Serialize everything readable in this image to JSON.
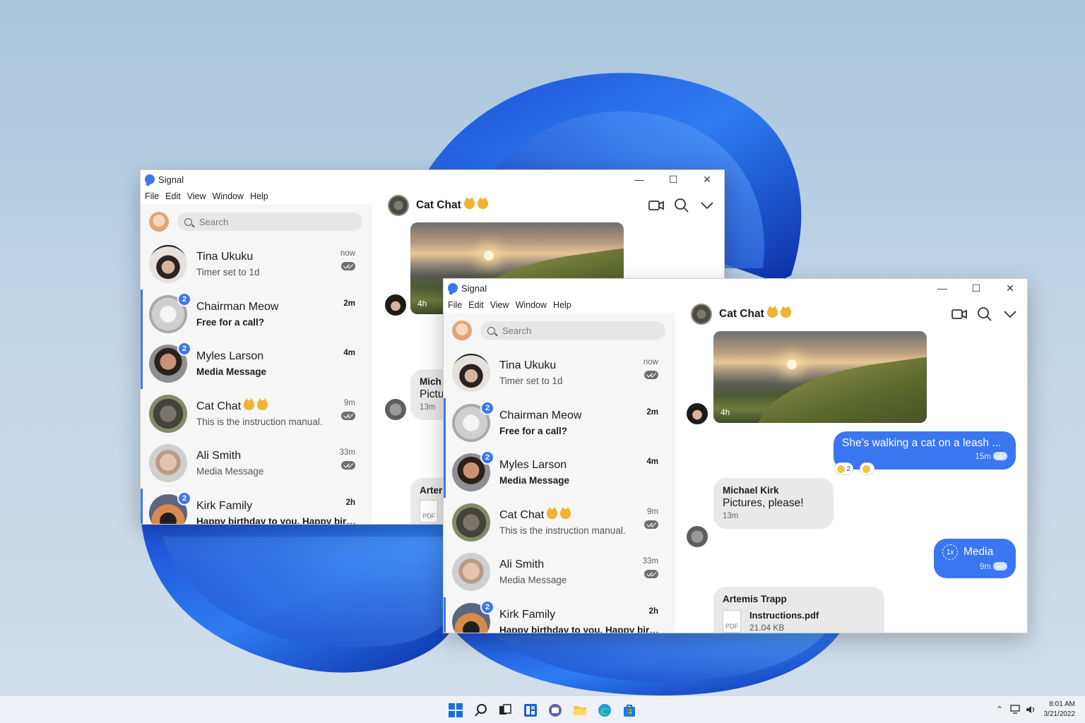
{
  "windows": [
    {
      "app_title": "Signal",
      "menu": [
        "File",
        "Edit",
        "View",
        "Window",
        "Help"
      ],
      "search_placeholder": "Search",
      "conversations": [
        {
          "name": "Tina Ukuku",
          "snippet": "Timer set to 1d",
          "time": "now",
          "unread": 0
        },
        {
          "name": "Chairman Meow",
          "snippet": "Free for a call?",
          "time": "2m",
          "unread": 2
        },
        {
          "name": "Myles Larson",
          "snippet": "Media Message",
          "time": "4m",
          "unread": 2
        },
        {
          "name": "Cat Chat",
          "snippet": "This is the instruction manual.",
          "time": "9m",
          "unread": 0
        },
        {
          "name": "Ali Smith",
          "snippet": "Media Message",
          "time": "33m",
          "unread": 0
        },
        {
          "name": "Kirk Family",
          "snippet": "Happy birthday to you. Happy birt...",
          "time": "2h",
          "unread": 2
        }
      ],
      "chat": {
        "title": "Cat Chat",
        "photo_time": "4h",
        "partial_author": "Mich",
        "partial_text": "Pictu",
        "partial_time": "13m",
        "partial_file_author": "Arter",
        "partial_file_type": "PDF"
      }
    },
    {
      "app_title": "Signal",
      "menu": [
        "File",
        "Edit",
        "View",
        "Window",
        "Help"
      ],
      "search_placeholder": "Search",
      "conversations": [
        {
          "name": "Tina Ukuku",
          "snippet": "Timer set to 1d",
          "time": "now",
          "unread": 0
        },
        {
          "name": "Chairman Meow",
          "snippet": "Free for a call?",
          "time": "2m",
          "unread": 2
        },
        {
          "name": "Myles Larson",
          "snippet": "Media Message",
          "time": "4m",
          "unread": 2
        },
        {
          "name": "Cat Chat",
          "snippet": "This is the instruction manual.",
          "time": "9m",
          "unread": 0
        },
        {
          "name": "Ali Smith",
          "snippet": "Media Message",
          "time": "33m",
          "unread": 0
        },
        {
          "name": "Kirk Family",
          "snippet": "Happy birthday to you. Happy birt...",
          "time": "2h",
          "unread": 2
        }
      ],
      "chat": {
        "title": "Cat Chat",
        "photo_time": "4h",
        "messages": {
          "out1": {
            "text": "She's walking a cat on a leash ...",
            "time": "15m",
            "reaction_count": "2"
          },
          "in1": {
            "author": "Michael Kirk",
            "text": "Pictures, please!",
            "time": "13m"
          },
          "out2": {
            "text": "Media",
            "view_once": "1x",
            "time": "9m"
          },
          "file": {
            "author": "Artemis Trapp",
            "filename": "Instructions.pdf",
            "size": "21.04 KB",
            "type": "PDF"
          }
        }
      }
    }
  ],
  "taskbar": {
    "time": "8:01 AM",
    "date": "3/21/2022"
  },
  "colors": {
    "accent": "#3a76f0",
    "wallpaper_blue": "#1f5fe0"
  }
}
